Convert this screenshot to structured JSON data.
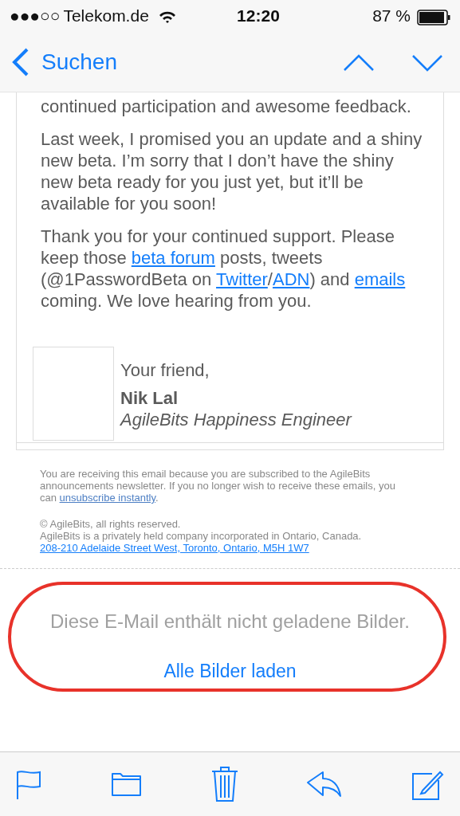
{
  "status_bar": {
    "signal": "●●●○○",
    "carrier": "Telekom.de",
    "time": "12:20",
    "battery": "87 %"
  },
  "nav": {
    "back": "Suchen"
  },
  "email": {
    "paragraphs": [
      [
        {
          "kind": "text",
          "text": "continued participation and awesome feedback."
        }
      ],
      [
        {
          "kind": "text",
          "text": "Last week, I promised you an update and a shiny new beta. I’m sorry that I don’t have the shiny new beta ready for you just yet, but it’ll be available for you soon!"
        }
      ],
      [
        {
          "kind": "text",
          "text": "Thank you for your continued support. Please keep those "
        },
        {
          "kind": "link",
          "text": "beta forum"
        },
        {
          "kind": "text",
          "text": " posts, tweets (@1PasswordBeta on "
        },
        {
          "kind": "link",
          "text": "Twitter"
        },
        {
          "kind": "text",
          "text": "/"
        },
        {
          "kind": "link",
          "text": "ADN"
        },
        {
          "kind": "text",
          "text": ") and "
        },
        {
          "kind": "link",
          "text": "emails"
        },
        {
          "kind": "text",
          "text": " coming. We love hearing from you."
        }
      ]
    ],
    "signature": {
      "greeting": "Your friend,",
      "name": "Nik Lal",
      "title": "AgileBits Happiness Engineer"
    },
    "footer": [
      [
        {
          "kind": "text",
          "text": "You are receiving this email because you are subscribed to the AgileBits announcements newsletter. If you no longer wish to receive these emails, you can "
        },
        {
          "kind": "muted-link",
          "text": "unsubscribe instantly"
        },
        {
          "kind": "text",
          "text": "."
        }
      ],
      [
        {
          "kind": "text",
          "text": "© AgileBits, all rights reserved."
        },
        {
          "kind": "break"
        },
        {
          "kind": "text",
          "text": "AgileBits is a privately held company incorporated in Ontario, Canada."
        },
        {
          "kind": "break"
        },
        {
          "kind": "link",
          "text": "208-210 Adelaide Street West, Toronto, Ontario, M5H 1W7"
        }
      ]
    ]
  },
  "images_notice": {
    "message": "Diese E-Mail enthält nicht geladene Bilder.",
    "action": "Alle Bilder laden"
  },
  "toolbar": [
    {
      "kind": "flag"
    },
    {
      "kind": "folder"
    },
    {
      "kind": "trash"
    },
    {
      "kind": "reply"
    },
    {
      "kind": "compose"
    }
  ]
}
